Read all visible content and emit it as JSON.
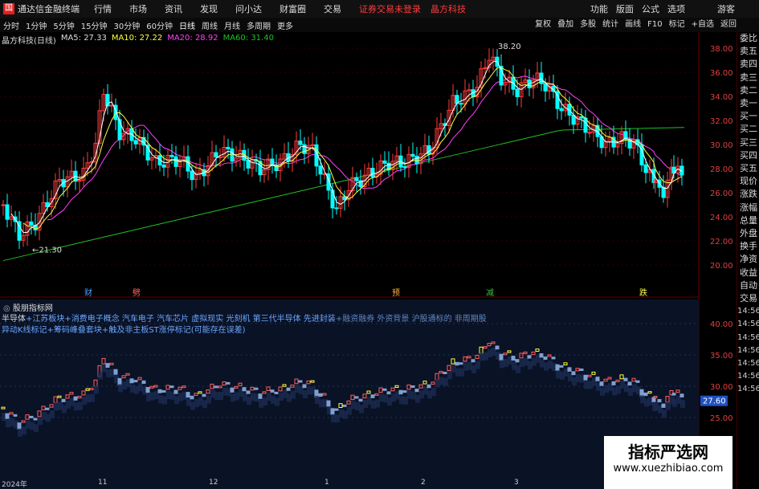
{
  "titlebar": {
    "logo": "国",
    "app_name": "通达信金融终端",
    "menu": [
      "行情",
      "市场",
      "资讯",
      "发现",
      "问小达",
      "财富圈",
      "交易"
    ],
    "notice": "证券交易未登录",
    "stock": "晶方科技",
    "right": [
      "功能",
      "版面",
      "公式",
      "选项",
      "游客"
    ]
  },
  "toolbar": {
    "periods": [
      "分时",
      "1分钟",
      "5分钟",
      "15分钟",
      "30分钟",
      "60分钟",
      "日线",
      "周线",
      "月线",
      "多周期",
      "更多"
    ],
    "active": "日线",
    "right": [
      "复权",
      "叠加",
      "多股",
      "统计",
      "画线",
      "F10",
      "标记",
      "+自选",
      "返回"
    ]
  },
  "legend": {
    "title": "晶方科技(日线)",
    "ma5": "MA5: 27.33",
    "ma10": "MA10: 27.22",
    "ma20": "MA20: 28.92",
    "ma60": "MA60: 31.40"
  },
  "colors": {
    "up": "#ff3b3b",
    "down": "#00ffff",
    "ma5": "#ffffff",
    "ma10": "#ffff40",
    "ma20": "#ff40ff",
    "ma60": "#20c020"
  },
  "chart_data": {
    "type": "candlestick",
    "price_axis": [
      "38.00",
      "36.00",
      "34.00",
      "32.00",
      "30.00",
      "28.00",
      "26.00",
      "24.00",
      "22.00",
      "20.00"
    ],
    "high_label": "38.20",
    "low_label": "21.30",
    "markers": [
      "财",
      "劈",
      "预",
      "减",
      "跌"
    ],
    "indicator_axis": [
      "40.00",
      "35.00",
      "30.00",
      "25.00"
    ],
    "indicator_value": "27.60",
    "dates": [
      "2024年",
      "11",
      "12",
      "1",
      "2",
      "3"
    ]
  },
  "indicator": {
    "title": "股朋指标网",
    "line1_head": "半导体",
    "line1_concepts": "+江苏板块+消费电子概念 汽车电子 汽车芯片 虚拟现实 光刻机 第三代半导体 先进封装",
    "line1_tail": "+融资融券 外资背景 沪股通标的 非周期股",
    "line2": "异动K线标记+筹码峰叠套块+触及非主板ST涨停标记(可能存在误差)"
  },
  "sidebar": [
    "委比",
    "卖五",
    "卖四",
    "卖三",
    "卖二",
    "卖一",
    "买一",
    "买二",
    "买三",
    "买四",
    "买五",
    "现价",
    "涨跌",
    "涨幅",
    "总量",
    "外盘",
    "换手",
    "净资",
    "收益",
    "自动",
    "交易",
    "14:56",
    "14:56",
    "14:56",
    "14:56",
    "14:56",
    "14:56",
    "14:56"
  ],
  "watermark": {
    "title": "指标严选网",
    "url": "www.xuezhibiao.com"
  }
}
